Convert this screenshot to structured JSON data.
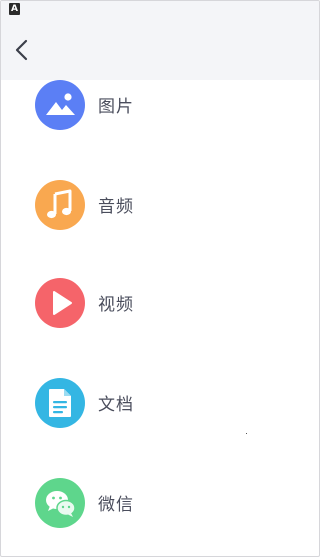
{
  "status_bar": {
    "indicator": "A"
  },
  "header": {
    "back_icon": "chevron-left-icon"
  },
  "categories": [
    {
      "label": "图片",
      "icon": "image-icon",
      "color": "#5b7ff5"
    },
    {
      "label": "音频",
      "icon": "music-note-icon",
      "color": "#f9a850"
    },
    {
      "label": "视频",
      "icon": "play-icon",
      "color": "#f5646a"
    },
    {
      "label": "文档",
      "icon": "document-icon",
      "color": "#34b6e3"
    },
    {
      "label": "微信",
      "icon": "wechat-icon",
      "color": "#5ed68c"
    }
  ]
}
